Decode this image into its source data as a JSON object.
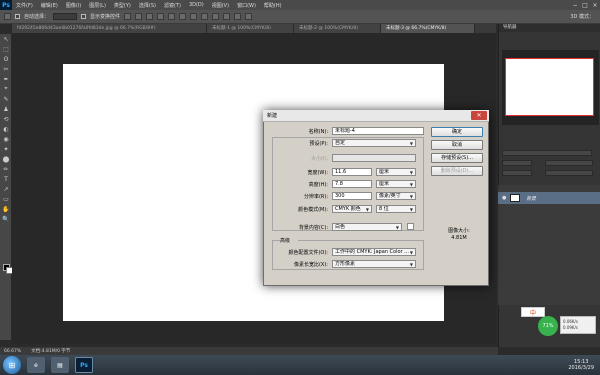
{
  "app": {
    "logo": "Ps",
    "menu": [
      "文件(F)",
      "编辑(E)",
      "图像(I)",
      "图层(L)",
      "类型(Y)",
      "选择(S)",
      "滤镜(T)",
      "3D(D)",
      "视图(V)",
      "窗口(W)",
      "帮助(H)"
    ],
    "window_controls": [
      "−",
      "□",
      "×"
    ]
  },
  "options_bar": {
    "auto_select_label": "自动选择：",
    "show_transform_label": "显示变换控件",
    "mode_3d_label": "3D 模式："
  },
  "doc_tabs": [
    {
      "label": "fd29245e866d43ae4b01276fa0fd83de.jpg @ 66.7%(RGB/8#)",
      "active": false
    },
    {
      "label": "未标题-1 @ 100%(CMYK/8)",
      "active": false
    },
    {
      "label": "未标题-2 @ 100%(CMYK/8)",
      "active": false
    },
    {
      "label": "未标题-3 @ 66.7%(CMYK/8)",
      "active": true
    }
  ],
  "tools": [
    "↖",
    "⬚",
    "ʘ",
    "✂",
    "✒",
    "⌖",
    "✎",
    "♟",
    "⟲",
    "◐",
    "◉",
    "✦",
    "⬤",
    "✏",
    "T",
    "↗",
    "▭",
    "✋",
    "🔍"
  ],
  "status": {
    "zoom": "66.67%",
    "doc_info": "文档:4.81M/0 字节"
  },
  "panels": {
    "navigator_tab": "导航器",
    "layer_name": "背景"
  },
  "taskbar": {
    "time": "15:13",
    "date": "2016/3/29"
  },
  "ime": {
    "label": "中",
    "percent": "71%",
    "stat1": "0.06K/s",
    "stat2": "0.09K/s"
  },
  "dialog": {
    "title": "新建",
    "name_label": "名称(N):",
    "name_value": "未标题-4",
    "preset_label": "预设(P):",
    "preset_value": "自定",
    "size_label": "大小(I):",
    "size_value": "",
    "width_label": "宽度(W):",
    "width_value": "11.6",
    "width_unit": "厘米",
    "height_label": "高度(H):",
    "height_value": "7.8",
    "height_unit": "厘米",
    "resolution_label": "分辨率(R):",
    "resolution_value": "300",
    "resolution_unit": "像素/英寸",
    "color_mode_label": "颜色模式(M):",
    "color_mode_value": "CMYK 颜色",
    "bit_depth_value": "8 位",
    "bg_label": "背景内容(C):",
    "bg_value": "白色",
    "advanced_label": "高级",
    "profile_label": "颜色配置文件(O):",
    "profile_value": "工作中的 CMYK: Japan Color ...",
    "aspect_label": "像素长宽比(X):",
    "aspect_value": "方形像素",
    "image_size_label": "图像大小:",
    "image_size_value": "4.81M",
    "ok": "确定",
    "cancel": "取消",
    "save_preset": "存储预设(S)...",
    "delete_preset": "删除预设(D)..."
  }
}
